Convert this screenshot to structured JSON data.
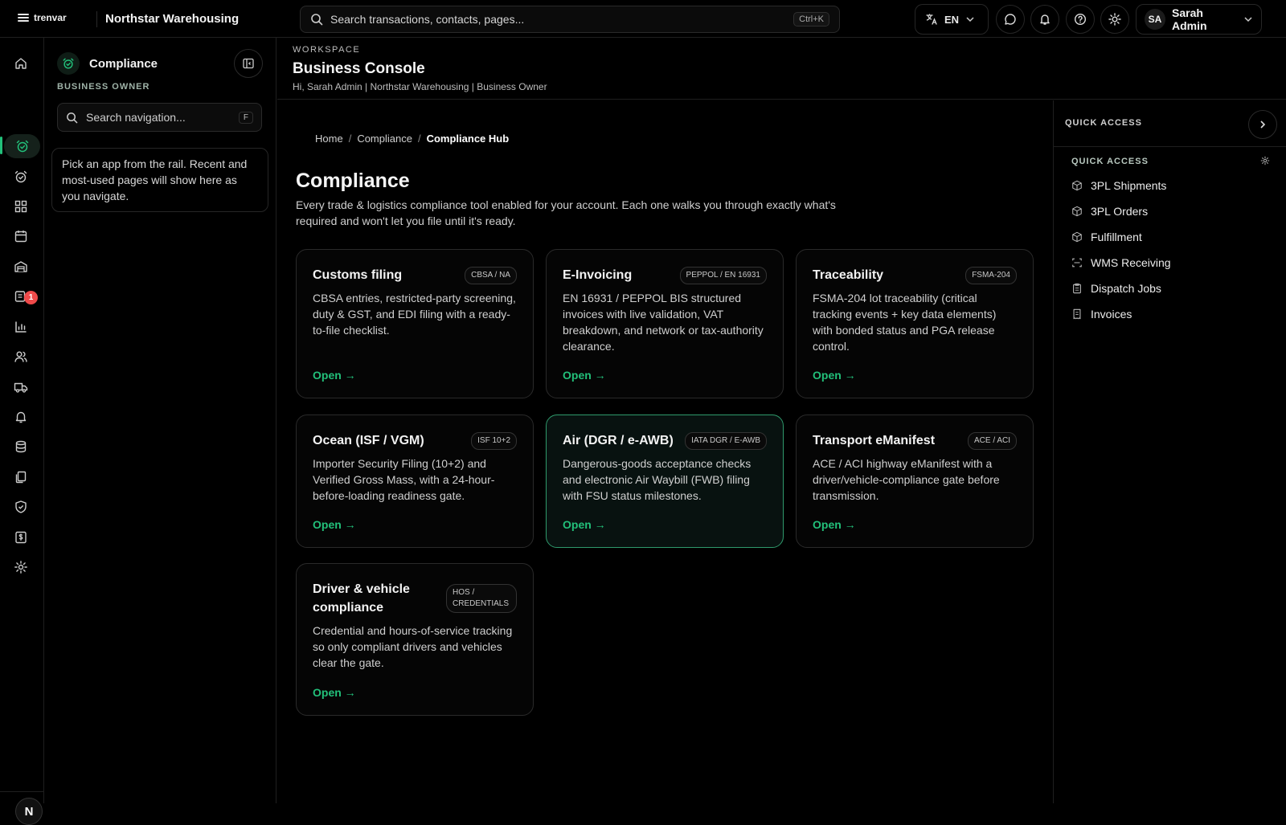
{
  "topbar": {
    "logo_text": "trenvar",
    "org_name": "Northstar Warehousing",
    "search_placeholder": "Search transactions, contacts, pages...",
    "search_shortcut": "Ctrl+K",
    "language": "EN",
    "user_initials": "SA",
    "user_name": "Sarah Admin"
  },
  "rail": {
    "notification_badge": "1",
    "bottom_avatar": "N"
  },
  "nav_panel": {
    "title": "Compliance",
    "role": "BUSINESS OWNER",
    "search_placeholder": "Search navigation...",
    "search_shortcut": "F",
    "hint": "Pick an app from the rail. Recent and most-used pages will show here as you navigate."
  },
  "header": {
    "workspace_label": "WORKSPACE",
    "title": "Business Console",
    "subtitle": "Hi, Sarah Admin | Northstar Warehousing | Business Owner"
  },
  "breadcrumb": [
    "Home",
    "Compliance",
    "Compliance Hub"
  ],
  "page": {
    "title": "Compliance",
    "description": "Every trade & logistics compliance tool enabled for your account. Each one walks you through exactly what's required and won't let you file until it's ready."
  },
  "cards": [
    {
      "title": "Customs filing",
      "tag": "CBSA / NA",
      "desc": "CBSA entries, restricted-party screening, duty & GST, and EDI filing with a ready-to-file checklist.",
      "action": "Open →"
    },
    {
      "title": "E-Invoicing",
      "tag": "PEPPOL / EN 16931",
      "desc": "EN 16931 / PEPPOL BIS structured invoices with live validation, VAT breakdown, and network or tax-authority clearance.",
      "action": "Open →"
    },
    {
      "title": "Traceability",
      "tag": "FSMA-204",
      "desc": "FSMA-204 lot traceability (critical tracking events + key data elements) with bonded status and PGA release control.",
      "action": "Open →"
    },
    {
      "title": "Ocean (ISF / VGM)",
      "tag": "ISF 10+2",
      "desc": "Importer Security Filing (10+2) and Verified Gross Mass, with a 24-hour-before-loading readiness gate.",
      "action": "Open →"
    },
    {
      "title": "Air (DGR / e-AWB)",
      "tag": "IATA DGR / E-AWB",
      "desc": "Dangerous-goods acceptance checks and electronic Air Waybill (FWB) filing with FSU status milestones.",
      "action": "Open →"
    },
    {
      "title": "Transport eManifest",
      "tag": "ACE / ACI",
      "desc": "ACE / ACI highway eManifest with a driver/vehicle-compliance gate before transmission.",
      "action": "Open →"
    },
    {
      "title": "Driver & vehicle compliance",
      "tag": "HOS / CREDENTIALS",
      "desc": "Credential and hours-of-service tracking so only compliant drivers and vehicles clear the gate.",
      "action": "Open →"
    }
  ],
  "quick_access": {
    "header": "QUICK ACCESS",
    "section_title": "QUICK ACCESS",
    "items": [
      {
        "label": "3PL Shipments",
        "icon": "box-icon"
      },
      {
        "label": "3PL Orders",
        "icon": "box-icon"
      },
      {
        "label": "Fulfillment",
        "icon": "box-icon"
      },
      {
        "label": "WMS Receiving",
        "icon": "scan-icon"
      },
      {
        "label": "Dispatch Jobs",
        "icon": "clipboard-icon"
      },
      {
        "label": "Invoices",
        "icon": "receipt-icon"
      }
    ]
  },
  "colors": {
    "accent": "#22c07a",
    "badge": "#ef4a4a",
    "background": "#000000"
  }
}
